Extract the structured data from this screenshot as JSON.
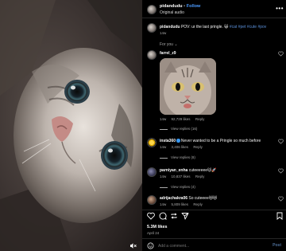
{
  "post": {
    "username": "pidandudu",
    "separator": "•",
    "follow_label": "Follow",
    "audio": "Original audio",
    "more_icon": "more-horizontal-icon"
  },
  "caption": {
    "username": "pidandudu",
    "text": "POV: ur the last pringle.",
    "emoji": "😺",
    "tags": "#cat #pet #cute #pov",
    "time": "14w"
  },
  "section_label": "For you",
  "comments": [
    {
      "username": "farrel_z9",
      "text": "",
      "time": "14w",
      "likes": "92,729 likes",
      "reply_label": "Reply",
      "view_replies": "View replies (16)",
      "has_gif": true
    },
    {
      "username": "insta360",
      "verified": true,
      "text": "Never wanted to be a Pringle so much before",
      "time": "14w",
      "likes": "3,406 likes",
      "reply_label": "Reply",
      "view_replies": "View replies (8)"
    },
    {
      "username": "parniyan_enha",
      "text": "cuteeeeee🐱🚀",
      "time": "14w",
      "likes": "10,837 likes",
      "reply_label": "Reply",
      "view_replies": "View replies (4)"
    },
    {
      "username": "adrijachakra06",
      "text": "So cuteeee😻😻",
      "time": "14w",
      "likes": "5,809 likes",
      "reply_label": "Reply"
    }
  ],
  "stats": {
    "likes": "5.3M likes",
    "date": "April 24"
  },
  "add_comment": {
    "placeholder": "Add a comment...",
    "post_label": "Post"
  },
  "colors": {
    "background": "#000000",
    "link_blue": "#4c9bff",
    "secondary_text": "#a8a8a8",
    "hashtag_blue": "#5a8fd8"
  }
}
